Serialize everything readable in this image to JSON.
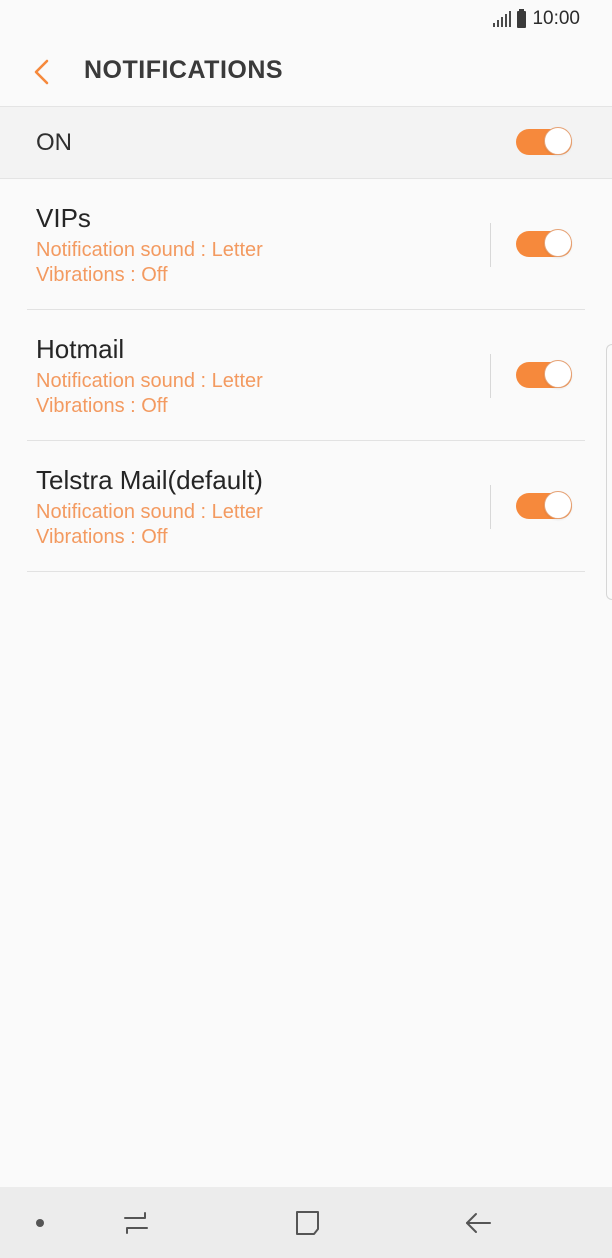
{
  "status_bar": {
    "time": "10:00",
    "icons": [
      "signal-icon",
      "battery-icon"
    ]
  },
  "header": {
    "title": "NOTIFICATIONS",
    "back_icon": "chevron-left-icon"
  },
  "master": {
    "label": "ON",
    "toggle_on": true
  },
  "accounts": [
    {
      "name": "VIPs",
      "sound": "Notification sound : Letter",
      "vibrations": "Vibrations : Off",
      "toggle_on": true
    },
    {
      "name": "Hotmail",
      "sound": "Notification sound : Letter",
      "vibrations": "Vibrations : Off",
      "toggle_on": true
    },
    {
      "name": "Telstra Mail(default)",
      "sound": "Notification sound : Letter",
      "vibrations": "Vibrations : Off",
      "toggle_on": true
    }
  ],
  "nav_bar": {
    "icons": [
      "dot-icon",
      "recent-apps-icon",
      "home-icon",
      "back-arrow-icon"
    ]
  },
  "colors": {
    "accent": "#f6893c",
    "subtext": "#f39a60",
    "background": "#fafafa"
  }
}
